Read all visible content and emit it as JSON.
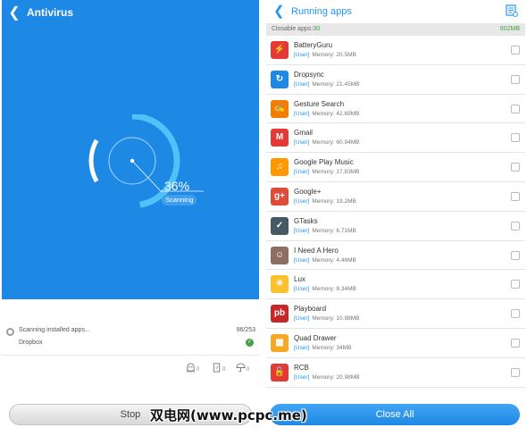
{
  "antivirus": {
    "title": "Antivirus",
    "progress_text": "36%",
    "progress_fraction": 0.36,
    "status_badge": "Scanning",
    "scan_label": "Scanning installed apps...",
    "scan_count": "96/253",
    "current_app": "Dropbox",
    "stats": [
      {
        "icon": "virus-icon",
        "value": "0"
      },
      {
        "icon": "suspicious-file-icon",
        "value": "0"
      },
      {
        "icon": "privacy-umbrella-icon",
        "value": "0"
      }
    ],
    "stop_label": "Stop",
    "colors": {
      "accent": "#1e88e5"
    }
  },
  "running_apps": {
    "title": "Running apps",
    "closable_label": "Closable apps:",
    "closable_count": "30",
    "total_memory": "602MB",
    "close_all_label": "Close All",
    "apps": [
      {
        "name": "BatteryGuru",
        "tag": "[User]",
        "memory": "Memory: 20.5MB",
        "icon": "batteryguru-icon",
        "color": "#e53935",
        "glyph": "⚡"
      },
      {
        "name": "Dropsync",
        "tag": "[User]",
        "memory": "Memory: 21.45MB",
        "icon": "dropsync-icon",
        "color": "#1e88e5",
        "glyph": "↻"
      },
      {
        "name": "Gesture Search",
        "tag": "[User]",
        "memory": "Memory: 42.69MB",
        "icon": "gesture-search-icon",
        "color": "#f57c00",
        "glyph": "✍"
      },
      {
        "name": "Gmail",
        "tag": "[User]",
        "memory": "Memory: 60.94MB",
        "icon": "gmail-icon",
        "color": "#e53935",
        "glyph": "M"
      },
      {
        "name": "Google Play Music",
        "tag": "[User]",
        "memory": "Memory: 17.83MB",
        "icon": "google-play-music-icon",
        "color": "#ff9800",
        "glyph": "♫"
      },
      {
        "name": "Google+",
        "tag": "[User]",
        "memory": "Memory: 19.2MB",
        "icon": "google-plus-icon",
        "color": "#dd4b39",
        "glyph": "g+"
      },
      {
        "name": "GTasks",
        "tag": "[User]",
        "memory": "Memory: 6.71MB",
        "icon": "gtasks-icon",
        "color": "#455a64",
        "glyph": "✓"
      },
      {
        "name": "I Need A Hero",
        "tag": "[User]",
        "memory": "Memory: 4.46MB",
        "icon": "i-need-a-hero-icon",
        "color": "#8d6e63",
        "glyph": "☺"
      },
      {
        "name": "Lux",
        "tag": "[User]",
        "memory": "Memory: 9.34MB",
        "icon": "lux-icon",
        "color": "#fbc02d",
        "glyph": "☀"
      },
      {
        "name": "Playboard",
        "tag": "[User]",
        "memory": "Memory: 10.98MB",
        "icon": "playboard-icon",
        "color": "#c62828",
        "glyph": "pb"
      },
      {
        "name": "Quad Drawer",
        "tag": "[User]",
        "memory": "Memory: 34MB",
        "icon": "quad-drawer-icon",
        "color": "#f9a825",
        "glyph": "▦"
      },
      {
        "name": "RCB",
        "tag": "[User]",
        "memory": "Memory: 20.98MB",
        "icon": "rcb-icon",
        "color": "#e53935",
        "glyph": "🔓"
      }
    ]
  },
  "watermark": "双电网(www.pcpc.me)"
}
